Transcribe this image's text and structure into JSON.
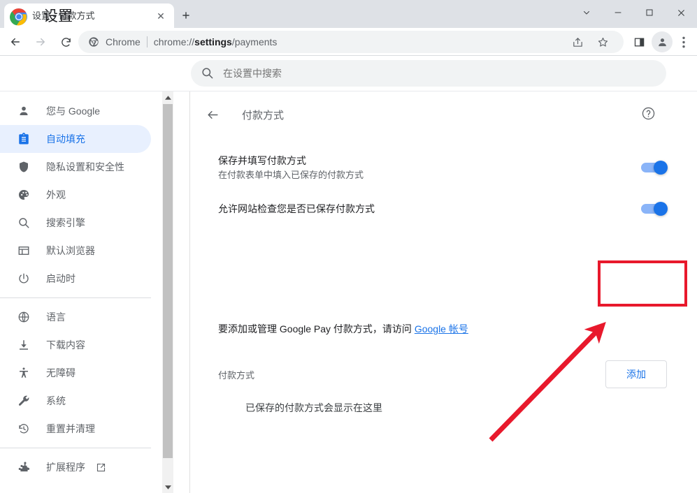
{
  "window": {
    "tab": {
      "title": "设置 - 付款方式",
      "favicon": "settings-gear-icon",
      "close_label": "✕"
    },
    "new_tab_label": "+",
    "controls": {
      "list_all_tabs": "⌄",
      "minimize": "—",
      "maximize": "☐",
      "close": "✕"
    }
  },
  "toolbar": {
    "back": "←",
    "forward": "→",
    "reload": "⟳",
    "omnibox": {
      "chrome_label": "Chrome",
      "url_prefix": "chrome://",
      "url_bold": "settings",
      "url_suffix": "/payments"
    },
    "share_icon": "share-icon",
    "bookmark_icon": "star-icon",
    "side_panel_icon": "side-panel-icon",
    "profile_icon": "profile-avatar-icon",
    "menu_icon": "three-dot-menu-icon"
  },
  "settings_header": {
    "title": "设置",
    "logo": "chrome-logo-icon"
  },
  "search": {
    "placeholder": "在设置中搜索",
    "value": "",
    "icon": "search-icon"
  },
  "sidebar": {
    "items": [
      {
        "label": "您与 Google",
        "icon": "person-icon",
        "active": false
      },
      {
        "label": "自动填充",
        "icon": "clipboard-icon",
        "active": true
      },
      {
        "label": "隐私设置和安全性",
        "icon": "shield-icon",
        "active": false
      },
      {
        "label": "外观",
        "icon": "palette-icon",
        "active": false
      },
      {
        "label": "搜索引擎",
        "icon": "search-icon",
        "active": false
      },
      {
        "label": "默认浏览器",
        "icon": "browser-window-icon",
        "active": false
      },
      {
        "label": "启动时",
        "icon": "power-icon",
        "active": false
      },
      {
        "label": "语言",
        "icon": "globe-icon",
        "active": false
      },
      {
        "label": "下载内容",
        "icon": "download-icon",
        "active": false
      },
      {
        "label": "无障碍",
        "icon": "accessibility-icon",
        "active": false
      },
      {
        "label": "系统",
        "icon": "wrench-icon",
        "active": false
      },
      {
        "label": "重置并清理",
        "icon": "history-restore-icon",
        "active": false
      },
      {
        "label": "扩展程序",
        "icon": "puzzle-piece-icon",
        "active": false,
        "external": "external-link-icon"
      }
    ]
  },
  "main": {
    "page_title": "付款方式",
    "back_arrow": "←",
    "help_icon": "help-circle-icon",
    "rows": [
      {
        "title": "保存并填写付款方式",
        "subtitle": "在付款表单中填入已保存的付款方式",
        "toggle_on": true
      },
      {
        "title": "允许网站检查您是否已保存付款方式",
        "subtitle": "",
        "toggle_on": true
      }
    ],
    "gpay_text": "要添加或管理 Google Pay 付款方式，请访问 ",
    "gpay_link": "Google 帐号",
    "section_label": "付款方式",
    "add_button": "添加",
    "empty_note": "已保存的付款方式会显示在这里"
  },
  "annotation": {
    "highlight_color": "#e8192c",
    "arrow_color": "#e8192c",
    "target": "添加"
  }
}
